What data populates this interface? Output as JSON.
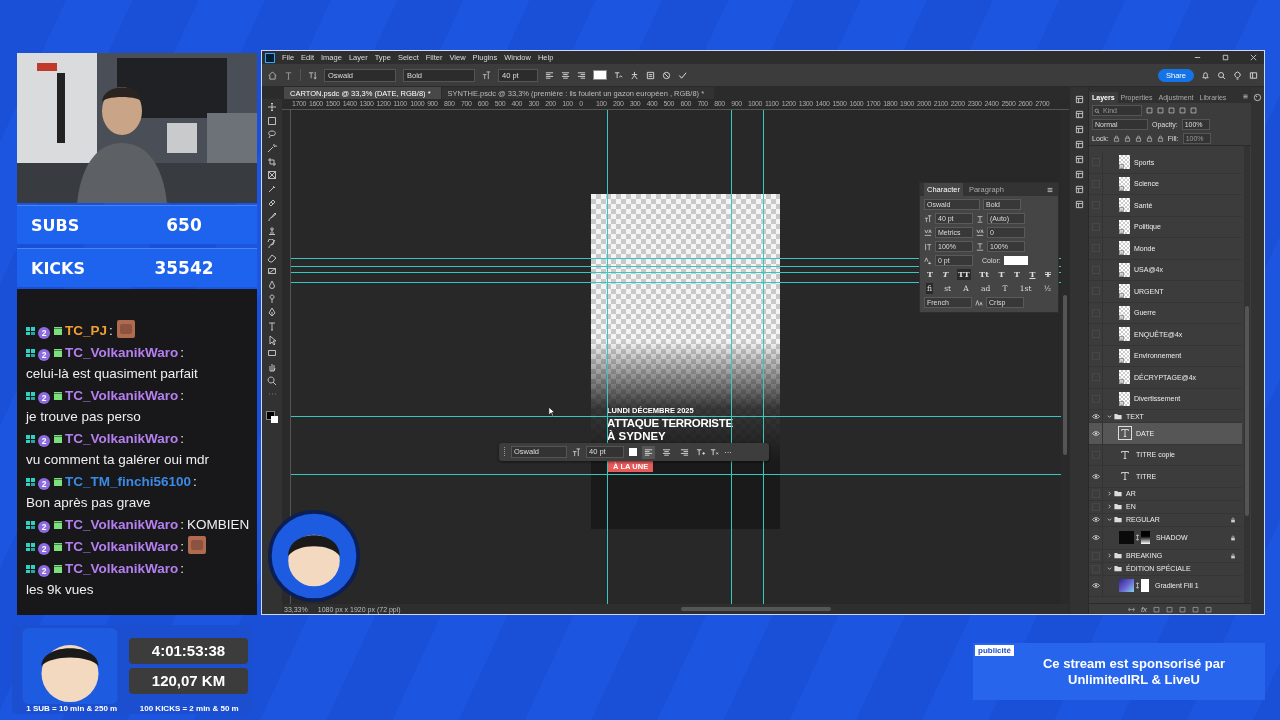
{
  "counters": [
    {
      "label": "SUBS",
      "value": "650"
    },
    {
      "label": "KICKS",
      "value": "35542"
    }
  ],
  "chat": {
    "separator": ":",
    "messages": [
      {
        "user": "TC_PJ",
        "color": "#f0a030",
        "badge": "2",
        "kind": "emote"
      },
      {
        "user": "TC_VolkanikWaro",
        "color": "#b57ff0",
        "badge": "2",
        "kind": "text",
        "text": "celui-là est quasiment parfait"
      },
      {
        "user": "TC_VolkanikWaro",
        "color": "#b57ff0",
        "badge": "2",
        "kind": "text",
        "text": "je trouve pas perso"
      },
      {
        "user": "TC_VolkanikWaro",
        "color": "#b57ff0",
        "badge": "2",
        "kind": "text",
        "text": "vu comment ta galérer oui mdr"
      },
      {
        "user": "TC_TM_finchi56100",
        "color": "#3a8ae6",
        "badge": "2",
        "kind": "text",
        "text": "Bon après pas grave"
      },
      {
        "user": "TC_VolkanikWaro",
        "color": "#b57ff0",
        "badge": "2",
        "kind": "text",
        "text": "KOMBIEN"
      },
      {
        "user": "TC_VolkanikWaro",
        "color": "#b57ff0",
        "badge": "2",
        "kind": "emote"
      },
      {
        "user": "TC_VolkanikWaro",
        "color": "#b57ff0",
        "badge": "2",
        "kind": "text",
        "text": "les 9k vues"
      }
    ]
  },
  "photoshop": {
    "menu": [
      "File",
      "Edit",
      "Image",
      "Layer",
      "Type",
      "Select",
      "Filter",
      "View",
      "Plugins",
      "Window",
      "Help"
    ],
    "options": {
      "font": "Oswald",
      "style": "Bold",
      "size": "40 pt",
      "share": "Share"
    },
    "documents": [
      {
        "title": "CARTON.psdc @ 33,3% (DATE, RGB/8) *",
        "selected": true
      },
      {
        "title": "SYNTHE.psdc @ 33,3% (première : ils foulent  un gazon européen , RGB/8) *",
        "selected": false
      }
    ],
    "ruler": [
      "1700",
      "1600",
      "1500",
      "1400",
      "1300",
      "1200",
      "1100",
      "1000",
      "900",
      "800",
      "700",
      "600",
      "500",
      "400",
      "300",
      "200",
      "100",
      "0",
      "100",
      "200",
      "300",
      "400",
      "500",
      "600",
      "700",
      "800",
      "900",
      "1000",
      "1100",
      "1200",
      "1300",
      "1400",
      "1500",
      "1600",
      "1700",
      "1800",
      "1900",
      "2000",
      "2100",
      "2200",
      "2300",
      "2400",
      "2500",
      "2600",
      "2700"
    ],
    "document": {
      "date": "LUNDI DÉCEMBRE 2025",
      "title": "ATTAQUE TERRORISTE",
      "title_line2": "À SYDNEY",
      "tag": "À LA UNE"
    },
    "floating_bar": {
      "font": "Oswald",
      "size": "40 pt",
      "align": [
        {
          "selected": true
        },
        {
          "selected": false
        },
        {
          "selected": false
        }
      ],
      "more": "···"
    },
    "character": {
      "tabs": [
        {
          "label": "Character",
          "selected": true
        },
        {
          "label": "Paragraph",
          "selected": false
        }
      ],
      "font": "Oswald",
      "style": "Bold",
      "size": "40 pt",
      "leading": "(Auto)",
      "kerning": "Metrics",
      "tracking": "0",
      "vscale": "100%",
      "hscale": "100%",
      "baseline": "0 pt",
      "color_label": "Color:",
      "styles": [
        {
          "label": "T",
          "kind": "bold",
          "selected": false
        },
        {
          "label": "T",
          "kind": "italic",
          "selected": false
        },
        {
          "label": "TT",
          "kind": "caps",
          "selected": true
        },
        {
          "label": "Tt",
          "kind": "smallcaps",
          "selected": false
        },
        {
          "label": "T",
          "kind": "super",
          "selected": false
        },
        {
          "label": "T",
          "kind": "sub",
          "selected": false
        },
        {
          "label": "T",
          "kind": "underline",
          "selected": false
        },
        {
          "label": "T",
          "kind": "strike",
          "selected": false
        }
      ],
      "opentype": [
        {
          "label": "fi",
          "selected": true
        },
        {
          "label": "st",
          "selected": false
        },
        {
          "label": "A",
          "selected": false
        },
        {
          "label": "ad",
          "selected": false
        },
        {
          "label": "T",
          "selected": false
        },
        {
          "label": "1st",
          "selected": false
        },
        {
          "label": "½",
          "selected": false
        }
      ],
      "language": "French",
      "antialias": "Crisp"
    },
    "panel_tabs": [
      {
        "label": "Layers",
        "selected": true
      },
      {
        "label": "Properties",
        "selected": false
      },
      {
        "label": "Adjustment",
        "selected": false
      },
      {
        "label": "Libraries",
        "selected": false
      }
    ],
    "layers_toolbar": {
      "search_placeholder": "Kind",
      "blend": "Normal",
      "opacity_label": "Opacity:",
      "opacity": "100%",
      "lock_label": "Lock:",
      "fill_label": "Fill:",
      "fill": "100%"
    },
    "layers": [
      {
        "name": "Sports",
        "kind": "smart",
        "visible": false,
        "selected": false,
        "locked": false
      },
      {
        "name": "Science",
        "kind": "smart",
        "visible": false,
        "selected": false,
        "locked": false
      },
      {
        "name": "Santé",
        "kind": "smart",
        "visible": false,
        "selected": false,
        "locked": false
      },
      {
        "name": "Politique",
        "kind": "smart",
        "visible": false,
        "selected": false,
        "locked": false
      },
      {
        "name": "Monde",
        "kind": "smart",
        "visible": false,
        "selected": false,
        "locked": false
      },
      {
        "name": "USA@4x",
        "kind": "smart",
        "visible": false,
        "selected": false,
        "locked": false
      },
      {
        "name": "URGENT",
        "kind": "smart",
        "visible": false,
        "selected": false,
        "locked": false
      },
      {
        "name": "Guerre",
        "kind": "smart",
        "visible": false,
        "selected": false,
        "locked": false
      },
      {
        "name": "ENQUÊTE@4x",
        "kind": "smart",
        "visible": false,
        "selected": false,
        "locked": false
      },
      {
        "name": "Environnement",
        "kind": "smart",
        "visible": false,
        "selected": false,
        "locked": false
      },
      {
        "name": "DÉCRYPTAGE@4x",
        "kind": "smart",
        "visible": false,
        "selected": false,
        "locked": false
      },
      {
        "name": "Divertissement",
        "kind": "smart",
        "visible": false,
        "selected": false,
        "locked": false
      },
      {
        "name": "TEXT",
        "kind": "group",
        "visible": true,
        "selected": false,
        "locked": false,
        "expanded": true,
        "children": [
          {
            "name": "DATE",
            "kind": "text",
            "visible": true,
            "selected": true,
            "locked": false
          },
          {
            "name": "TITRE copie",
            "kind": "text",
            "visible": false,
            "selected": false,
            "locked": false
          },
          {
            "name": "TITRE",
            "kind": "text",
            "visible": true,
            "selected": false,
            "locked": false
          }
        ]
      },
      {
        "name": "AR",
        "kind": "group",
        "visible": false,
        "selected": false,
        "locked": false,
        "expanded": false
      },
      {
        "name": "EN",
        "kind": "group",
        "visible": false,
        "selected": false,
        "locked": false,
        "expanded": false
      },
      {
        "name": "REGULAR",
        "kind": "group",
        "visible": true,
        "selected": false,
        "locked": true,
        "expanded": true,
        "children": [
          {
            "name": "SHADOW",
            "kind": "pixel",
            "visible": true,
            "selected": false,
            "locked": true
          }
        ]
      },
      {
        "name": "BREAKING",
        "kind": "group",
        "visible": false,
        "selected": false,
        "locked": true,
        "expanded": false
      },
      {
        "name": "ÉDITION SPÉCIALE",
        "kind": "group",
        "visible": false,
        "selected": false,
        "locked": false,
        "expanded": true,
        "children": [
          {
            "name": "Gradient Fill 1",
            "kind": "fill",
            "visible": true,
            "selected": false,
            "locked": false
          }
        ]
      }
    ],
    "layers_footer": "fx",
    "status": {
      "zoom": "33,33%",
      "size": "1080 px x 1920 px (72 ppi)"
    }
  },
  "timer": {
    "time": "4:01:53:38",
    "distance": "120,07 KM",
    "rules": [
      "1 SUB = 10 min & 250 m",
      "100 KICKS = 2 min & 50 m"
    ]
  },
  "sponsor": {
    "tag": "publicité",
    "lines": [
      "Ce stream est sponsorisé par",
      "UnlimitedIRL & LiveU"
    ]
  }
}
